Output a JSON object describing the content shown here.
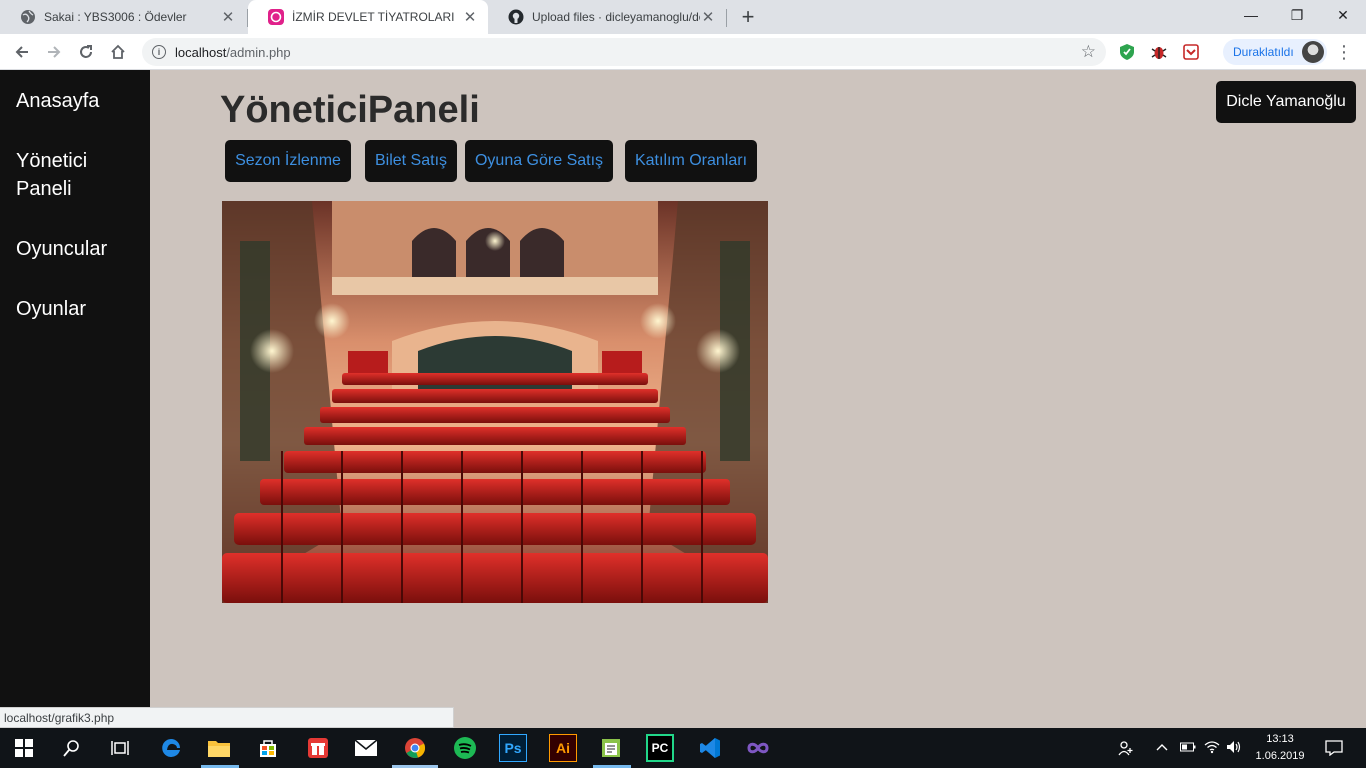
{
  "browser": {
    "tabs": [
      {
        "title": "Sakai : YBS3006 : Ödevler",
        "icon": "globe-icon",
        "active": false
      },
      {
        "title": "İZMİR DEVLET TİYATROLARI",
        "icon": "theatre-site-icon",
        "active": true
      },
      {
        "title": "Upload files · dicleyamanoglu/dc",
        "icon": "github-icon",
        "active": false
      }
    ],
    "new_tab_glyph": "+",
    "window_controls": {
      "minimize": "—",
      "maximize": "❐",
      "close": "✕"
    },
    "url": {
      "host": "localhost",
      "path": "/admin.php"
    },
    "info_glyph": "i",
    "bookmark_glyph": "☆",
    "profile_label": "Duraklatıldı",
    "status_url": "localhost/grafik3.php",
    "accent": "#1a73e8"
  },
  "sidebar": {
    "items": [
      {
        "label": "Anasayfa"
      },
      {
        "label": "Yönetici Paneli"
      },
      {
        "label": "Oyuncular"
      },
      {
        "label": "Oyunlar"
      }
    ]
  },
  "main": {
    "title": "YöneticiPaneli",
    "user_button": "Dicle Yamanoğlu",
    "nav_buttons": [
      {
        "label": "Sezon İzlenme"
      },
      {
        "label": "Bilet Satış"
      },
      {
        "label": "Oyuna Göre Satış"
      },
      {
        "label": "Katılım Oranları"
      }
    ],
    "hero_image": "theatre-auditorium-red-seats",
    "link_color": "#3d8fe0",
    "bg_color": "#cdc4be"
  },
  "taskbar": {
    "apps": [
      "windows-start-icon",
      "search-icon",
      "task-view-icon",
      "edge-icon",
      "file-explorer-icon",
      "store-icon",
      "gift-app-icon",
      "mail-icon",
      "chrome-icon",
      "spotify-icon",
      "photoshop-icon",
      "illustrator-icon",
      "notepad-icon",
      "pycharm-icon",
      "vscode-icon",
      "infinity-app-icon"
    ],
    "app_glyphs": {
      "photoshop-icon": "Ps",
      "illustrator-icon": "Ai",
      "pycharm-icon": "PC"
    },
    "time": "13:13",
    "date": "1.06.2019"
  }
}
